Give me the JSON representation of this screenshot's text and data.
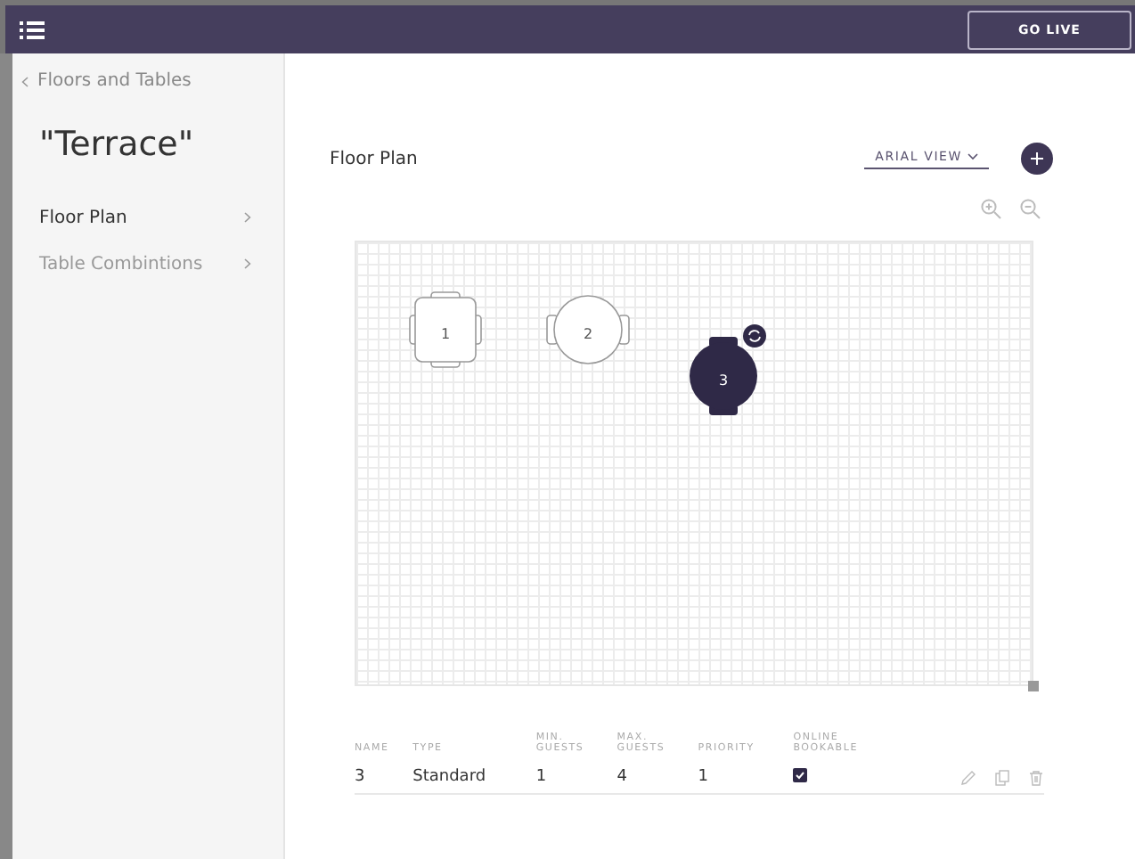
{
  "top_bar": {
    "go_live_button": "GO LIVE"
  },
  "sidebar": {
    "back_link": "Floors and Tables",
    "floor_title": "\"Terrace\"",
    "items": [
      {
        "label": "Floor Plan",
        "selected": true
      },
      {
        "label": "Table Combintions",
        "selected": false
      }
    ]
  },
  "main": {
    "title": "Floor Plan",
    "view_dropdown": "ARIAL VIEW",
    "tables": [
      {
        "label": "1",
        "kind": "square",
        "selected": false
      },
      {
        "label": "2",
        "kind": "round",
        "selected": false
      },
      {
        "label": "3",
        "kind": "round",
        "selected": true
      }
    ],
    "table": {
      "columns": [
        "NAME",
        "TYPE",
        "MIN.\nGUESTS",
        "MAX.\nGUESTS",
        "PRIORITY",
        "ONLINE\nBOOKABLE"
      ],
      "rows": [
        {
          "cells": [
            "3",
            "Standard",
            "1",
            "4",
            "1"
          ],
          "online_bookable": true
        }
      ]
    }
  }
}
